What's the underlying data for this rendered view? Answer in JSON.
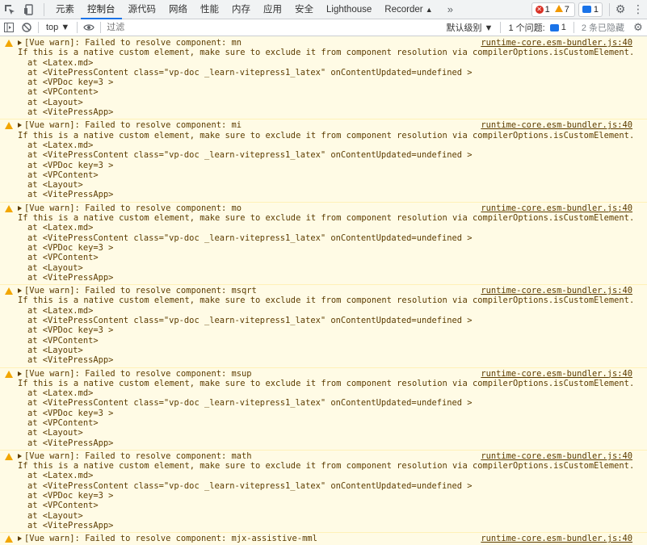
{
  "toolbar": {
    "tabs": [
      "元素",
      "控制台",
      "源代码",
      "网络",
      "性能",
      "内存",
      "应用",
      "安全",
      "Lighthouse",
      "Recorder"
    ],
    "active_tab": "控制台",
    "more_label": "»",
    "error_count": "1",
    "warning_count": "7",
    "message_count": "1"
  },
  "filterbar": {
    "context": "top ▼",
    "filter_placeholder": "过滤",
    "levels": "默认级别 ▼",
    "issues_label": "1 个问题:",
    "issues_count": "1",
    "hidden": "2 条已隐藏"
  },
  "console": {
    "source": "runtime-core.esm-bundler.js:40",
    "detail": "If this is a native custom element, make sure to exclude it from component resolution via compilerOptions.isCustomElement.",
    "stack": [
      "at <Latex.md>",
      "at <VitePressContent class=\"vp-doc _learn-vitepress1_latex\" onContentUpdated=undefined >",
      "at <VPDoc key=3 >",
      "at <VPContent>",
      "at <Layout>",
      "at <VitePressApp>"
    ],
    "messages": [
      "[Vue warn]: Failed to resolve component: mn",
      "[Vue warn]: Failed to resolve component: mi",
      "[Vue warn]: Failed to resolve component: mo",
      "[Vue warn]: Failed to resolve component: msqrt",
      "[Vue warn]: Failed to resolve component: msup",
      "[Vue warn]: Failed to resolve component: math",
      "[Vue warn]: Failed to resolve component: mjx-assistive-mml"
    ]
  },
  "colors": {
    "warning_bg": "#fffbe5",
    "warning_text": "#5c3c00",
    "accent": "#1a73e8",
    "error": "#d93025",
    "warning": "#f29900"
  }
}
